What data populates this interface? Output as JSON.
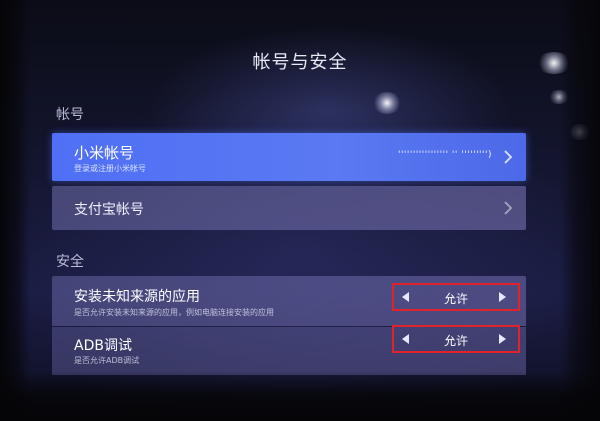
{
  "page": {
    "title": "帐号与安全"
  },
  "sections": {
    "account": {
      "label": "帐号",
      "items": [
        {
          "title": "小米帐号",
          "subtitle": "登录或注册小米帐号",
          "value": "'''''''''''''''''  ''  ''''''''')",
          "focused": true
        },
        {
          "title": "支付宝帐号"
        }
      ]
    },
    "security": {
      "label": "安全",
      "items": [
        {
          "title": "安装未知来源的应用",
          "subtitle": "是否允许安装未知来源的应用，例如电脑连接安装的应用",
          "value": "允许"
        },
        {
          "title": "ADB调试",
          "subtitle": "是否允许ADB调试",
          "value": "允许"
        }
      ]
    }
  },
  "colors": {
    "focus_row": "#5573f2",
    "highlight_box": "#e0232a",
    "text_primary": "#ffffff"
  },
  "icons": {
    "chevron": "chevron-right-icon",
    "selector_prev": "arrow-left-icon",
    "selector_next": "arrow-right-icon"
  }
}
